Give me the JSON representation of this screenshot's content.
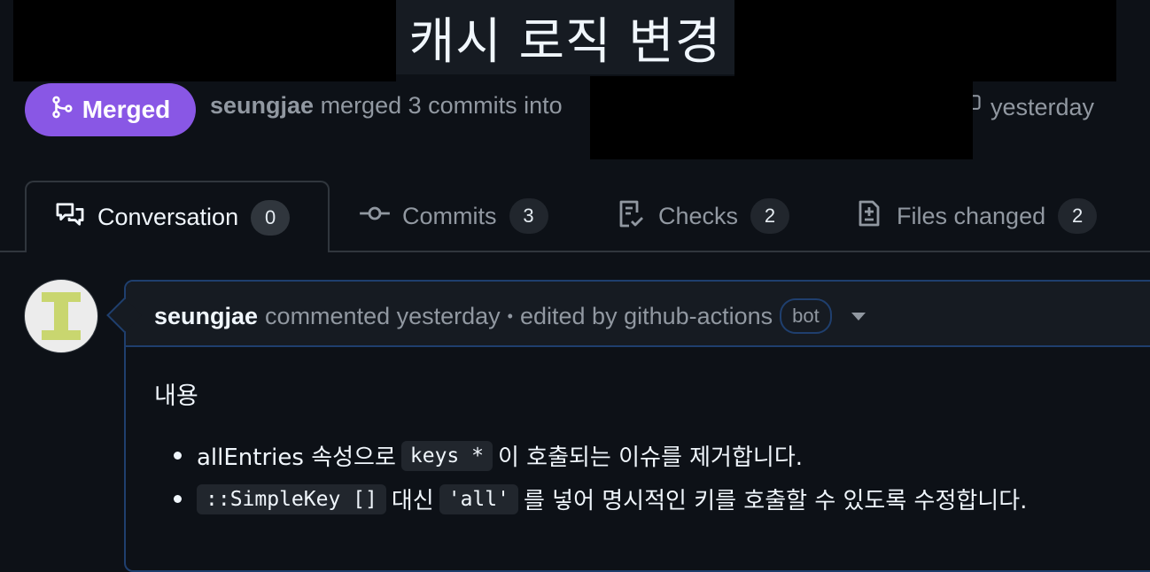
{
  "header": {
    "title": "캐시 로직 변경"
  },
  "status": {
    "badge_label": "Merged",
    "author": "seungjae",
    "action_text": "merged 3 commits into",
    "time": "yesterday"
  },
  "tabs": [
    {
      "label": "Conversation",
      "count": "0",
      "icon": "comment-discussion-icon"
    },
    {
      "label": "Commits",
      "count": "3",
      "icon": "git-commit-icon"
    },
    {
      "label": "Checks",
      "count": "2",
      "icon": "checklist-icon"
    },
    {
      "label": "Files changed",
      "count": "2",
      "icon": "file-diff-icon"
    }
  ],
  "comment": {
    "author": "seungjae",
    "action": "commented yesterday",
    "separator": "•",
    "edited": "edited by github-actions",
    "bot_label": "bot",
    "heading": "내용",
    "bullets": [
      {
        "before": "allEntries 속성으로",
        "code": "keys *",
        "after": "이 호출되는 이슈를 제거합니다."
      },
      {
        "code1": "::SimpleKey []",
        "middle": "대신",
        "code2": "'all'",
        "after": "를 넣어 명시적인 키를 호출할 수 있도록 수정합니다."
      }
    ]
  },
  "colors": {
    "background": "#0d1117",
    "merged": "#8957e5",
    "accent_border": "#1f3f6e",
    "avatar_glyph": "#c9d66f"
  }
}
